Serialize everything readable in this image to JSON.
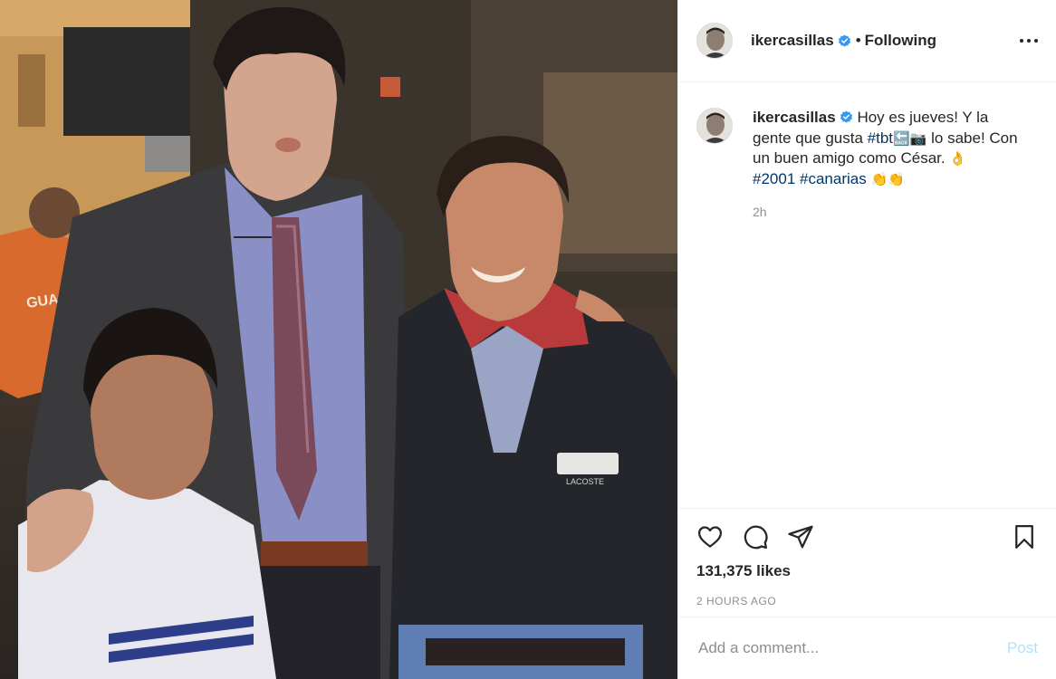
{
  "photo": {
    "alt_icon": "photo",
    "shirt_logo": "LACOSTE",
    "steward_vest_text": "GUARD"
  },
  "header": {
    "username": "ikercasillas",
    "separator": "•",
    "follow_status": "Following",
    "verified_icon": "verified-badge-icon",
    "more_icon": "more-options-icon"
  },
  "caption": {
    "username": "ikercasillas",
    "text_1": "Hoy es jueves! Y la gente que gusta ",
    "tag_tbt": "#tbt",
    "emoji_back": "🔙",
    "emoji_camera": "📷",
    "text_2": " lo sabe! Con un buen amigo como César. ",
    "emoji_ok": "👌",
    "tag_2001": "#2001",
    "tag_canarias": "#canarias",
    "emoji_hands": "👏👏",
    "time_ago": "2h"
  },
  "actions": {
    "like_icon": "heart-icon",
    "comment_icon": "comment-icon",
    "share_icon": "share-icon",
    "save_icon": "bookmark-icon"
  },
  "likes": "131,375 likes",
  "posted_at": "2 HOURS AGO",
  "comment": {
    "placeholder": "Add a comment...",
    "post_label": "Post"
  },
  "colors": {
    "text": "#262626",
    "muted": "#8e8e8e",
    "link": "#00376b",
    "verified": "#3897f0",
    "post_disabled": "#b2dffc",
    "divider": "#efefef"
  }
}
